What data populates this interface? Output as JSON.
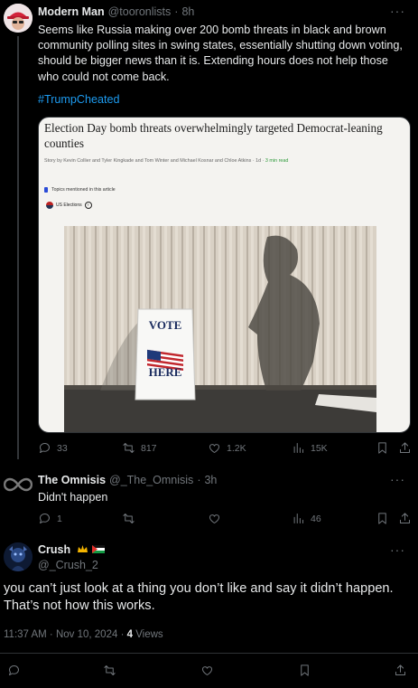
{
  "post1": {
    "author_name": "Modern Man",
    "handle": "@tooronlists",
    "time": "8h",
    "text": "Seems like Russia making over 200 bomb threats in black and brown community polling sites in swing states, essentially shutting down voting, should be bigger news than it is. Extending hours does not help those who could not come back.",
    "hashtag": "#TrumpCheated",
    "card": {
      "title": "Election Day bomb threats overwhelmingly targeted Democrat-leaning counties",
      "byline": "Story by Kevin Collier and Tyler Kingkade and Tom Winter and Michael Kosnar and Chloe Atkins",
      "age": "1d",
      "read_time": "3 min read",
      "topics_label": "Topics mentioned in this article",
      "topic_chip": "US Elections",
      "sign_top": "VOTE",
      "sign_bottom": "HERE"
    },
    "replies": "33",
    "reposts": "817",
    "likes": "1.2K",
    "views": "15K"
  },
  "post2": {
    "author_name": "The Omnisis",
    "handle": "@_The_Omnisis",
    "time": "3h",
    "text": "Didn't happen",
    "replies": "1",
    "reposts": "",
    "likes": "",
    "views": "46"
  },
  "main_post": {
    "author_name": "Crush",
    "handle": "@_Crush_2",
    "text": "you can’t just look at a thing you don’t like and say it didn’t happen. That’s not how this works.",
    "timestamp": "11:37 AM · Nov 10, 2024",
    "views_count": "4",
    "views_label": "Views"
  },
  "colors": {
    "background": "#000000",
    "text": "#e7e9ea",
    "muted": "#71767b",
    "link": "#1d9bf0",
    "divider": "#2f3336"
  },
  "icons": [
    "reply-icon",
    "repost-icon",
    "like-icon",
    "views-icon",
    "bookmark-icon",
    "share-icon",
    "more-icon"
  ]
}
